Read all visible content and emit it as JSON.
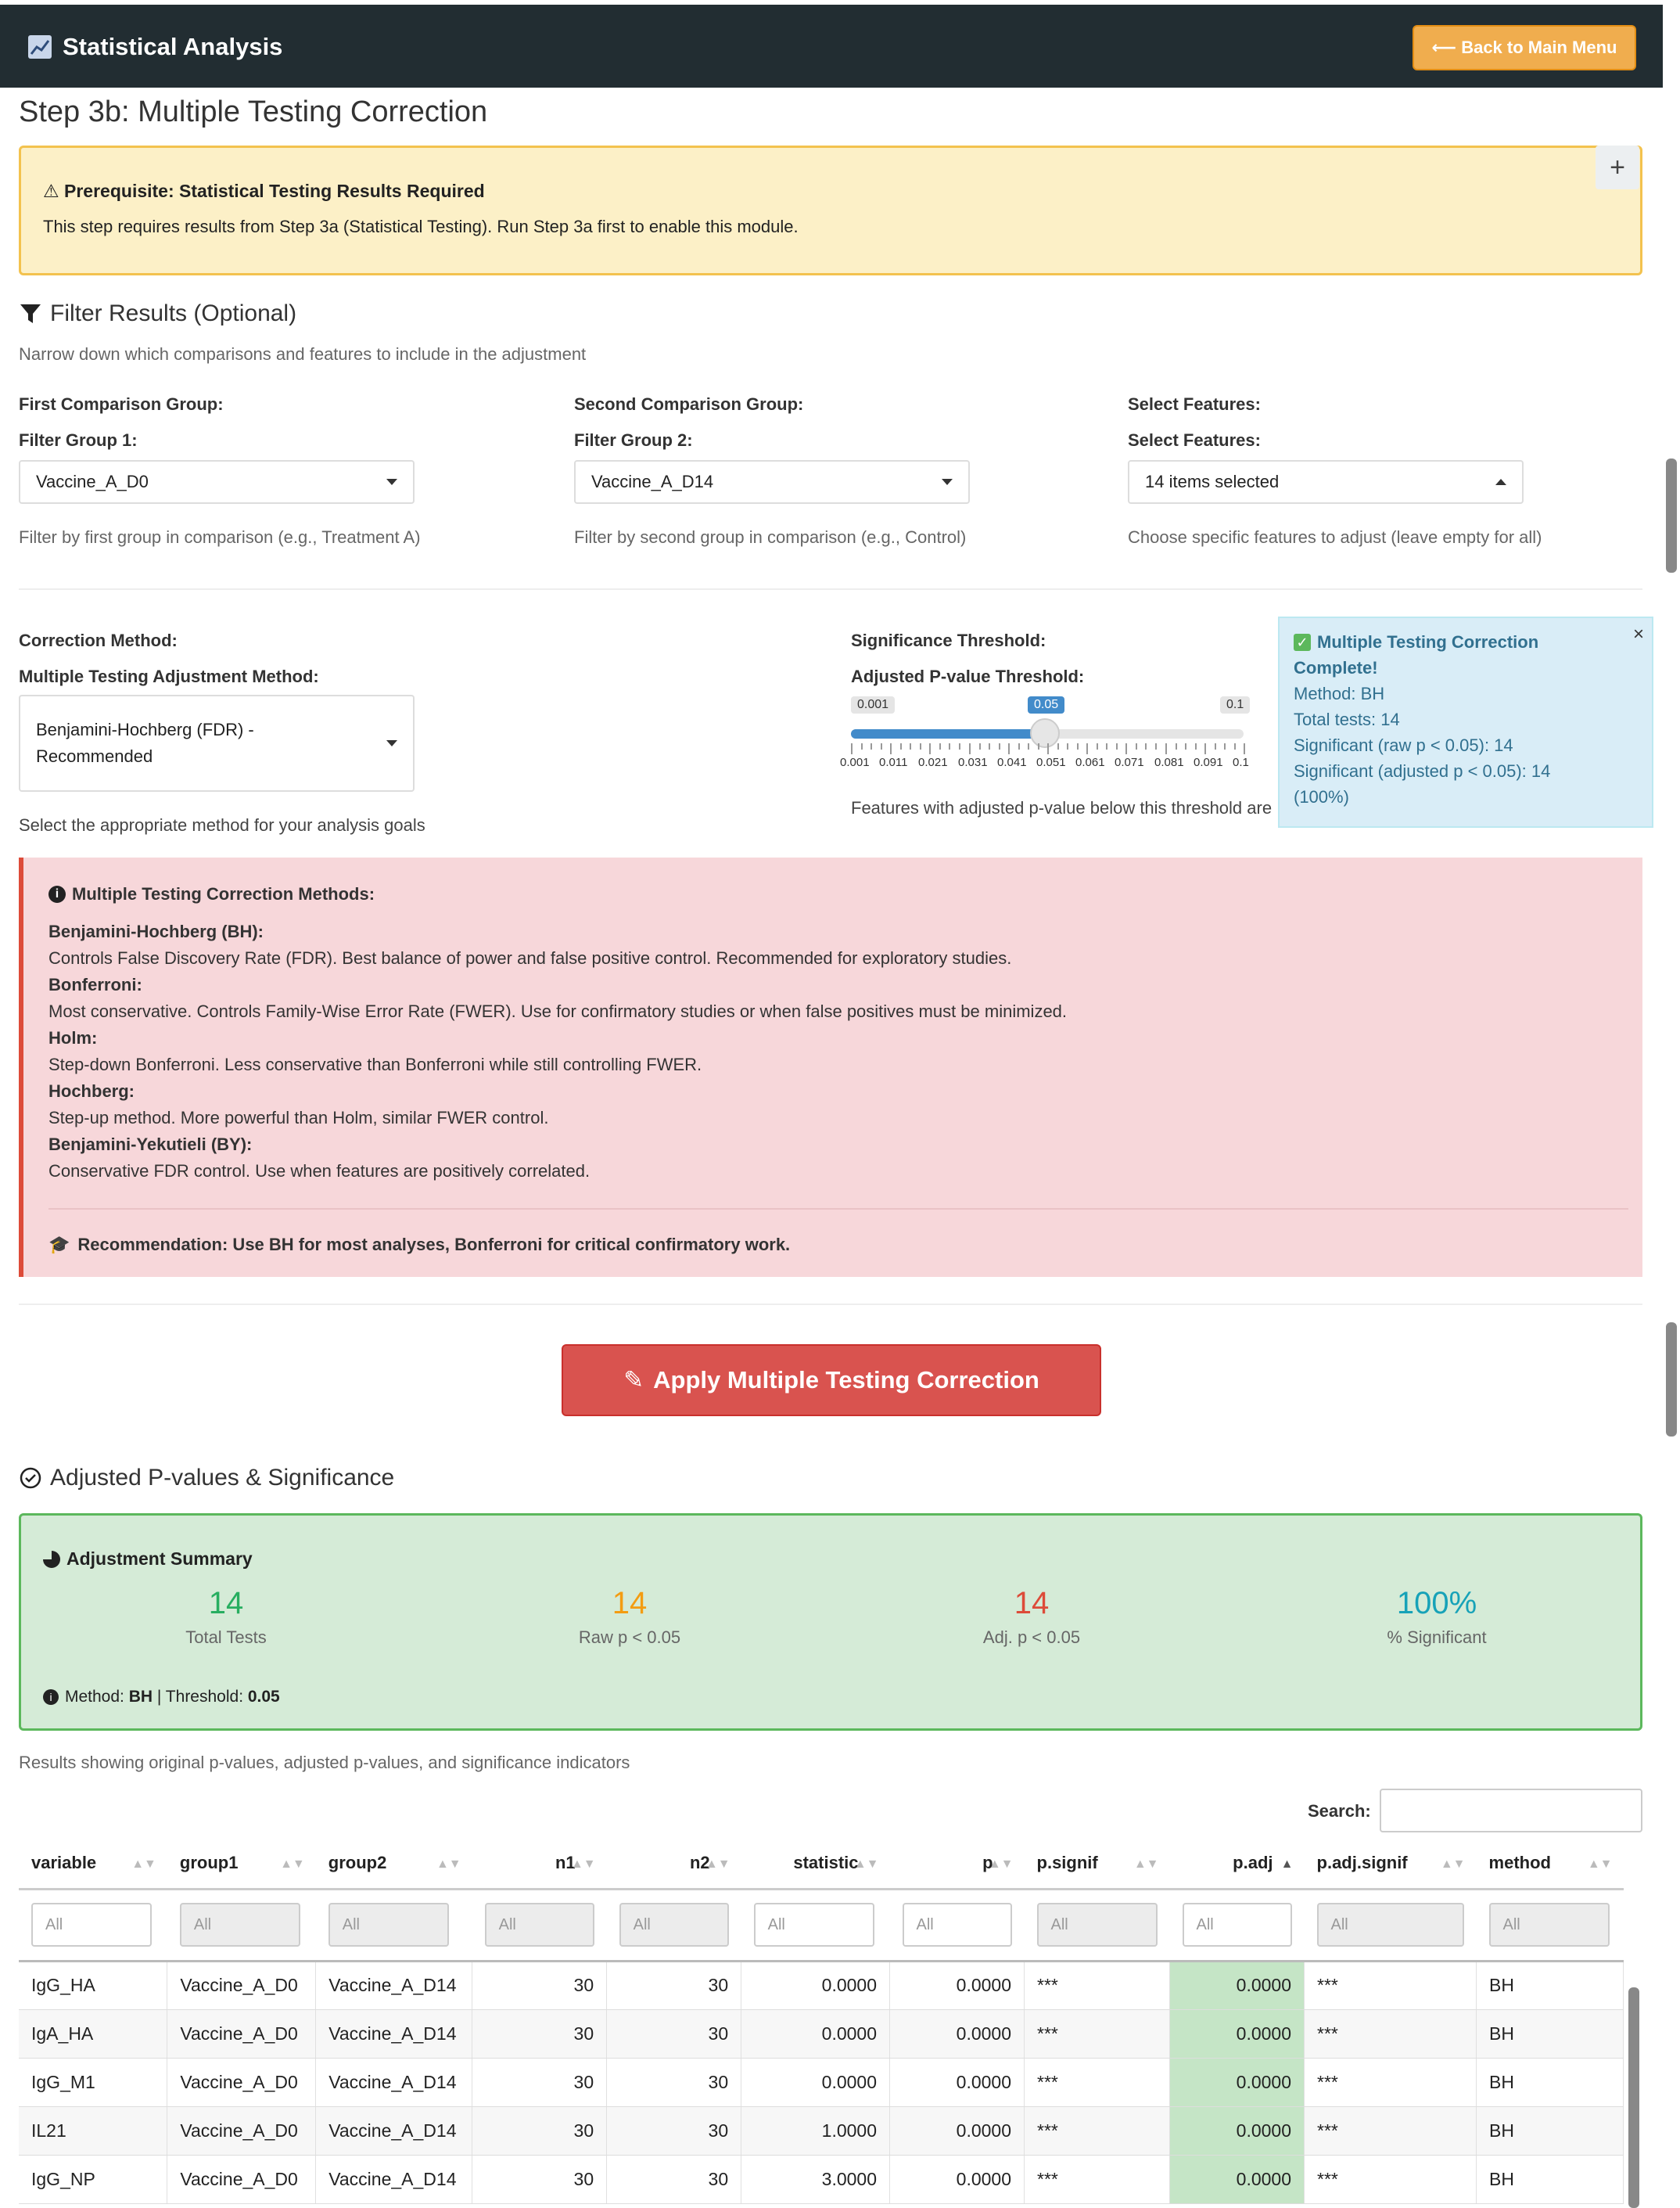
{
  "header": {
    "app_title": "Statistical Analysis",
    "back_label": "⟵ Back to Main Menu"
  },
  "step_title": "Step 3b: Multiple Testing Correction",
  "prereq": {
    "heading": "Prerequisite: Statistical Testing Results Required",
    "text": "This step requires results from Step 3a (Statistical Testing). Run Step 3a first to enable this module.",
    "expand_label": "+"
  },
  "filter": {
    "heading": "Filter Results (Optional)",
    "subtitle": "Narrow down which comparisons and features to include in the adjustment",
    "group1": {
      "section": "First Comparison Group:",
      "label": "Filter Group 1:",
      "value": "Vaccine_A_D0",
      "help": "Filter by first group in comparison (e.g., Treatment A)"
    },
    "group2": {
      "section": "Second Comparison Group:",
      "label": "Filter Group 2:",
      "value": "Vaccine_A_D14",
      "help": "Filter by second group in comparison (e.g., Control)"
    },
    "features": {
      "section": "Select Features:",
      "label": "Select Features:",
      "value": "14 items selected",
      "help": "Choose specific features to adjust (leave empty for all)"
    }
  },
  "correction": {
    "section": "Correction Method:",
    "label": "Multiple Testing Adjustment Method:",
    "value_line1": "Benjamini-Hochberg (FDR) -",
    "value_line2": "Recommended",
    "help": "Select the appropriate method for your analysis goals"
  },
  "threshold": {
    "section": "Significance Threshold:",
    "label": "Adjusted P-value Threshold:",
    "min_label": "0.001",
    "max_label": "0.1",
    "value_label": "0.05",
    "value": 0.05,
    "min": 0.001,
    "max": 0.1,
    "ticks": [
      "0.001",
      "0.011",
      "0.021",
      "0.031",
      "0.041",
      "0.051",
      "0.061",
      "0.071",
      "0.081",
      "0.091",
      "0.1"
    ],
    "help": "Features with adjusted p-value below this threshold are considered significant"
  },
  "notification": {
    "title_line1": "Multiple Testing Correction",
    "title_line2": "Complete!",
    "lines": [
      "Method: BH",
      "Total tests: 14",
      "Significant (raw p < 0.05): 14",
      "Significant (adjusted p < 0.05): 14",
      "(100%)"
    ],
    "close": "×"
  },
  "methods_info": {
    "heading": "Multiple Testing Correction Methods:",
    "items": [
      {
        "name": "Benjamini-Hochberg (BH):",
        "desc": "Controls False Discovery Rate (FDR). Best balance of power and false positive control. Recommended for exploratory studies."
      },
      {
        "name": "Bonferroni:",
        "desc": "Most conservative. Controls Family-Wise Error Rate (FWER). Use for confirmatory studies or when false positives must be minimized."
      },
      {
        "name": "Holm:",
        "desc": "Step-down Bonferroni. Less conservative than Bonferroni while still controlling FWER."
      },
      {
        "name": "Hochberg:",
        "desc": "Step-up method. More powerful than Holm, similar FWER control."
      },
      {
        "name": "Benjamini-Yekutieli (BY):",
        "desc": "Conservative FDR control. Use when features are positively correlated."
      }
    ],
    "recommendation": "Recommendation: Use BH for most analyses, Bonferroni for critical confirmatory work."
  },
  "apply_label": "Apply Multiple Testing Correction",
  "results": {
    "heading": "Adjusted P-values & Significance",
    "summary_title": "Adjustment Summary",
    "stats": [
      {
        "value": "14",
        "label": "Total Tests",
        "color": "#27ae60"
      },
      {
        "value": "14",
        "label": "Raw p < 0.05",
        "color": "#f39c12"
      },
      {
        "value": "14",
        "label": "Adj. p < 0.05",
        "color": "#dd4b39"
      },
      {
        "value": "100%",
        "label": "% Significant",
        "color": "#17a2b8"
      }
    ],
    "method_prefix": "Method: ",
    "method": "BH",
    "threshold_prefix": " | Threshold: ",
    "threshold": "0.05",
    "caption": "Results showing original p-values, adjusted p-values, and significance indicators",
    "search_label": "Search:"
  },
  "table": {
    "columns": [
      "variable",
      "group1",
      "group2",
      "n1",
      "n2",
      "statistic",
      "p",
      "p.signif",
      "p.adj",
      "p.adj.signif",
      "method"
    ],
    "filter_placeholder": "All",
    "rows": [
      [
        "IgG_HA",
        "Vaccine_A_D0",
        "Vaccine_A_D14",
        "30",
        "30",
        "0.0000",
        "0.0000",
        "***",
        "0.0000",
        "***",
        "BH"
      ],
      [
        "IgA_HA",
        "Vaccine_A_D0",
        "Vaccine_A_D14",
        "30",
        "30",
        "0.0000",
        "0.0000",
        "***",
        "0.0000",
        "***",
        "BH"
      ],
      [
        "IgG_M1",
        "Vaccine_A_D0",
        "Vaccine_A_D14",
        "30",
        "30",
        "0.0000",
        "0.0000",
        "***",
        "0.0000",
        "***",
        "BH"
      ],
      [
        "IL21",
        "Vaccine_A_D0",
        "Vaccine_A_D14",
        "30",
        "30",
        "1.0000",
        "0.0000",
        "***",
        "0.0000",
        "***",
        "BH"
      ],
      [
        "IgG_NP",
        "Vaccine_A_D0",
        "Vaccine_A_D14",
        "30",
        "30",
        "3.0000",
        "0.0000",
        "***",
        "0.0000",
        "***",
        "BH"
      ]
    ]
  }
}
